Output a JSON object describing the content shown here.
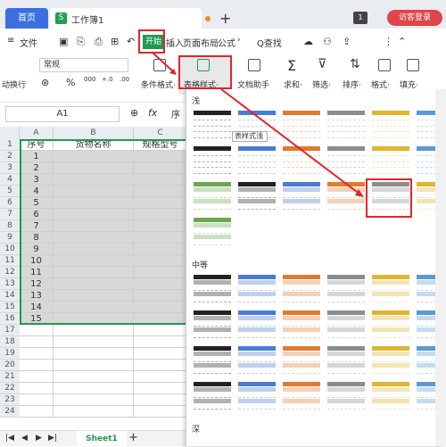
{
  "tabs": {
    "home": "首页",
    "doc_icon": "S",
    "doc_title": "工作簿1",
    "new_tab": "+",
    "badge": "1",
    "visitor": "访客登录"
  },
  "menu": {
    "hamburger": "≡",
    "file": "文件",
    "start": "开始",
    "insert": "插入",
    "page_layout": "页面布局",
    "formula": "公式",
    "search": "Q查找"
  },
  "ribbon": {
    "wrap": "动换行",
    "format_combo": "常规",
    "percent": "%",
    "cond_format": "条件格式·",
    "table_style": "表格样式·",
    "doc_helper": "文档助手",
    "sum": "求和·",
    "filter": "筛选·",
    "sort": "排序·",
    "format": "格式·",
    "fill": "填充·"
  },
  "formula": {
    "name_box": "A1",
    "fx": "fx",
    "content": "序"
  },
  "grid": {
    "cols": [
      "A",
      "B",
      "C"
    ],
    "headers": [
      "序号",
      "货物名称",
      "规格型号"
    ],
    "rows": [
      "1",
      "2",
      "3",
      "4",
      "5",
      "6",
      "7",
      "8",
      "9",
      "10",
      "11",
      "12",
      "13",
      "14",
      "15"
    ],
    "row_numbers": [
      "1",
      "2",
      "3",
      "4",
      "5",
      "6",
      "7",
      "8",
      "9",
      "10",
      "11",
      "12",
      "13",
      "14",
      "15",
      "16",
      "17",
      "18",
      "19",
      "20",
      "21",
      "22",
      "23",
      "24"
    ]
  },
  "sheets": {
    "active": "Sheet1",
    "add": "+"
  },
  "gallery": {
    "light": "浅",
    "medium": "中等",
    "dark": "深",
    "tooltip": "表样式浅"
  },
  "colors": {
    "accent": "#1e9b50",
    "highlight_red": "#e2252b",
    "blue": "#3b6fe0"
  }
}
